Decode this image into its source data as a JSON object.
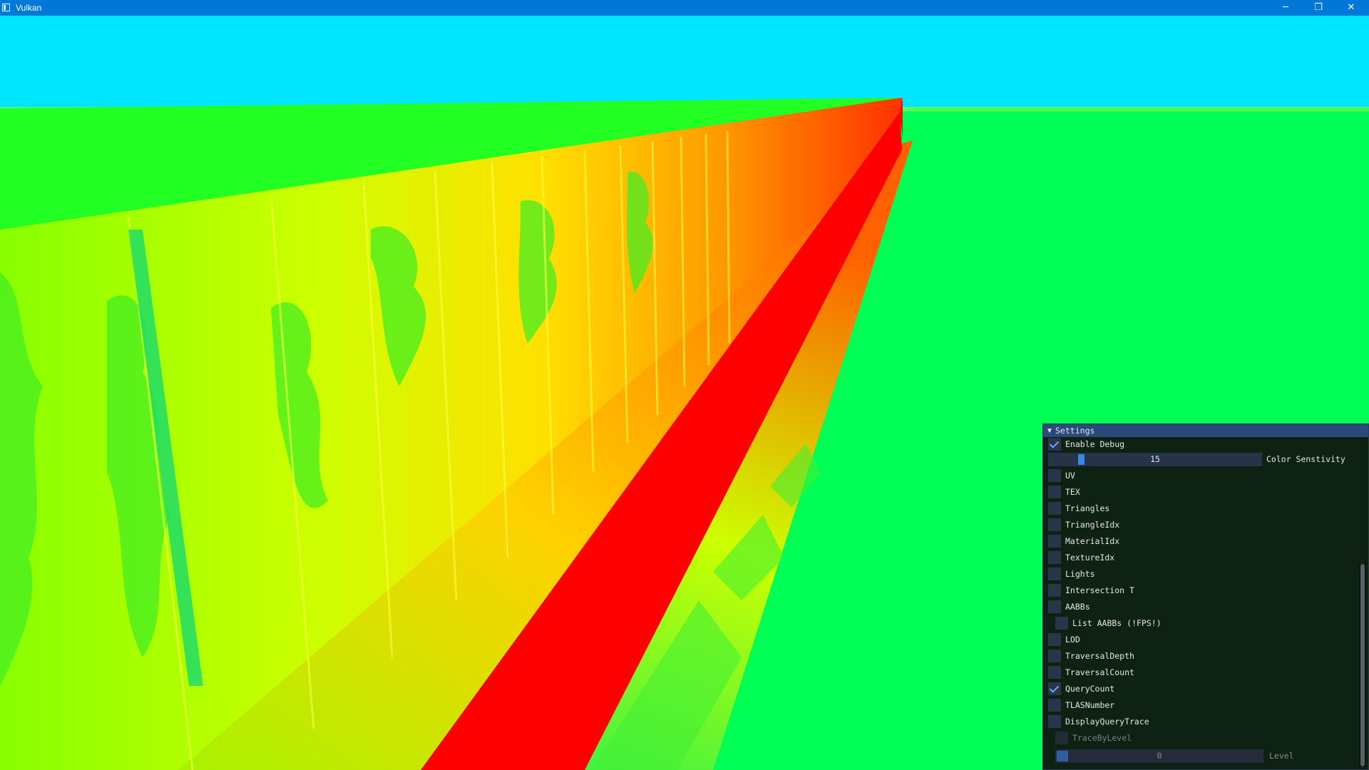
{
  "window": {
    "title": "Vulkan",
    "controls": {
      "minimize": "─",
      "restore": "❐",
      "close": "✕"
    }
  },
  "colors": {
    "sky": "#00e5ff",
    "ground": "#00ff55",
    "titlebar": "#0078d7",
    "panel_header": "#294a7a",
    "checkbox": "#2a344a",
    "slider_grab": "#3d85e0",
    "heat_low": "#00ff40",
    "heat_mid": "#ffff00",
    "heat_high": "#ff0000"
  },
  "settings": {
    "title": "Settings",
    "enable_debug": {
      "label": "Enable Debug",
      "checked": true
    },
    "color_sensitivity": {
      "label": "Color Senstivity",
      "value": "15",
      "fraction": 0.14
    },
    "options": [
      {
        "label": "UV",
        "checked": false
      },
      {
        "label": "TEX",
        "checked": false
      },
      {
        "label": "Triangles",
        "checked": false
      },
      {
        "label": "TriangleIdx",
        "checked": false
      },
      {
        "label": "MaterialIdx",
        "checked": false
      },
      {
        "label": "TextureIdx",
        "checked": false
      },
      {
        "label": "Lights",
        "checked": false
      },
      {
        "label": "Intersection T",
        "checked": false
      },
      {
        "label": "AABBs",
        "checked": false
      },
      {
        "label": "List AABBs (!FPS!)",
        "checked": false
      },
      {
        "label": "LOD",
        "checked": false
      },
      {
        "label": "TraversalDepth",
        "checked": false
      },
      {
        "label": "TraversalCount",
        "checked": false
      },
      {
        "label": "QueryCount",
        "checked": true
      },
      {
        "label": "TLASNumber",
        "checked": false
      },
      {
        "label": "DisplayQueryTrace",
        "checked": false
      },
      {
        "label": "TraceByLevel",
        "checked": false
      }
    ],
    "level": {
      "label": "Level",
      "value": "0",
      "fraction": 0.0
    }
  }
}
